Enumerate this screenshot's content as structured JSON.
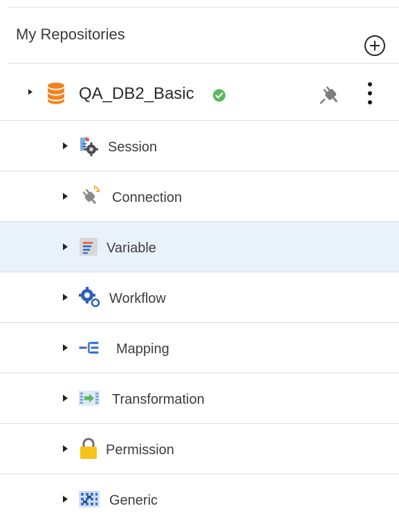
{
  "header": {
    "title": "My Repositories",
    "add_icon": "add-circle-icon"
  },
  "repository": {
    "name": "QA_DB2_Basic",
    "icon": "database-icon",
    "status_icon": "connected-check-icon",
    "status_color": "#5cb85c",
    "connect_icon": "plug-icon",
    "menu_icon": "kebab-menu-icon"
  },
  "colors": {
    "db_orange": "#f5821f",
    "selected_row_bg": "#e9f2fb",
    "divider": "#dcdcdc",
    "accent_blue": "#2a6bd6"
  },
  "tree": {
    "items": [
      {
        "label": "Session",
        "icon": "session-icon",
        "selected": false
      },
      {
        "label": "Connection",
        "icon": "connection-plug-icon",
        "selected": false
      },
      {
        "label": "Variable",
        "icon": "variable-icon",
        "selected": true
      },
      {
        "label": "Workflow",
        "icon": "workflow-icon",
        "selected": false
      },
      {
        "label": "Mapping",
        "icon": "mapping-icon",
        "selected": false
      },
      {
        "label": "Transformation",
        "icon": "transformation-icon",
        "selected": false
      },
      {
        "label": "Permission",
        "icon": "lock-icon",
        "selected": false
      },
      {
        "label": "Generic",
        "icon": "generic-icon",
        "selected": false
      }
    ]
  }
}
